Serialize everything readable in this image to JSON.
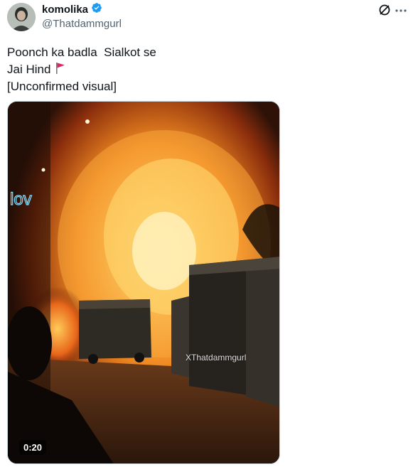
{
  "author": {
    "display_name": "komolika",
    "handle": "@Thatdammgurl",
    "verified_icon": "verified-badge-icon"
  },
  "actions": {
    "grok_icon": "grok-icon",
    "more_icon": "more-icon"
  },
  "tweet": {
    "lines": [
      "Poonch ka badla  Sialkot se",
      "Jai Hind",
      "[Unconfirmed visual]"
    ],
    "flag_icon": "red-flag-icon"
  },
  "media": {
    "watermark": "XThatdammgurl",
    "duration": "0:20"
  },
  "colors": {
    "text": "#0f1419",
    "secondary": "#536471",
    "verified": "#1d9bf0",
    "flag": "#e0245e"
  }
}
